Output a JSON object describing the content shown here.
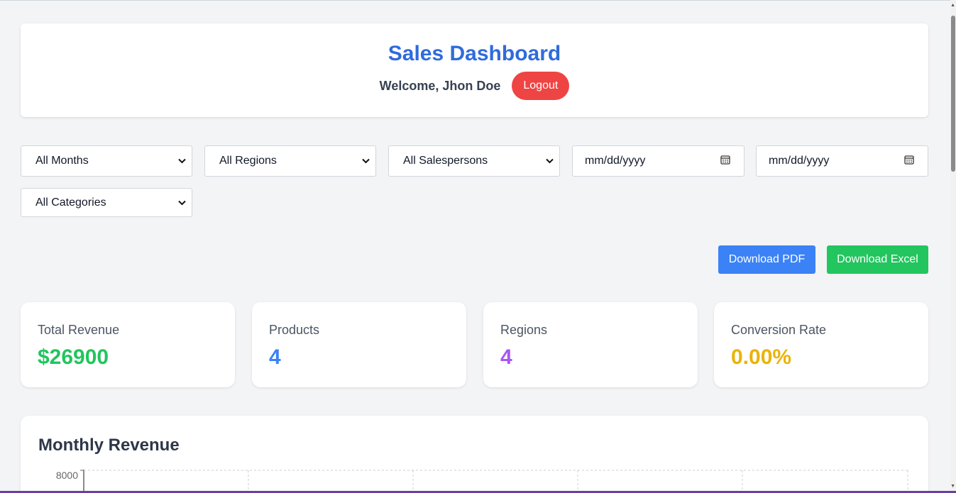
{
  "header": {
    "title": "Sales Dashboard",
    "welcome": "Welcome, Jhon Doe",
    "logout_label": "Logout"
  },
  "filters": {
    "month": "All Months",
    "region": "All Regions",
    "salesperson": "All Salespersons",
    "start_date": "mm/dd/yyyy",
    "end_date": "mm/dd/yyyy",
    "category": "All Categories"
  },
  "actions": {
    "pdf_label": "Download PDF",
    "excel_label": "Download Excel"
  },
  "stats": [
    {
      "label": "Total Revenue",
      "value": "$26900",
      "color": "#22c55e"
    },
    {
      "label": "Products",
      "value": "4",
      "color": "#3b82f6"
    },
    {
      "label": "Regions",
      "value": "4",
      "color": "#a855f7"
    },
    {
      "label": "Conversion Rate",
      "value": "0.00%",
      "color": "#eab308"
    }
  ],
  "chart": {
    "title": "Monthly Revenue"
  },
  "chart_data": {
    "type": "bar",
    "title": "Monthly Revenue",
    "y_ticks": [
      "8000"
    ],
    "ylim": [
      0,
      8000
    ],
    "grid": true,
    "categories": [],
    "values": []
  },
  "icons": {
    "select_chevron": "chevron-down-icon",
    "date_picker": "calendar-icon"
  }
}
